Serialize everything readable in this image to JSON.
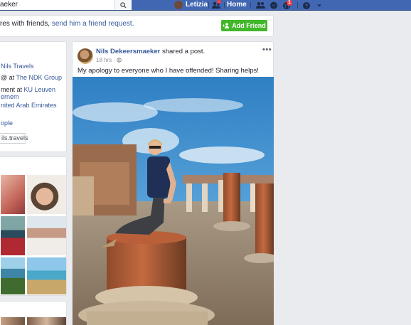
{
  "topbar": {
    "search_value": "aeker",
    "user_name": "Letizia",
    "home_label": "Home",
    "friend_requests_badge": "",
    "notifications_badge": "1",
    "brand_color": "#4267b2"
  },
  "banner": {
    "text_prefix": "res with friends, ",
    "text_link": "send him a friend request.",
    "add_friend_label": "Add Friend",
    "button_color": "#42b72a"
  },
  "intro": {
    "lines": [
      {
        "pre": "",
        "link": "Nils Travels"
      },
      {
        "pre": "@ at ",
        "link": "The NDK Group"
      },
      {
        "pre": "ment at ",
        "link": "KU Leuven"
      },
      {
        "pre": "",
        "link": "ernem"
      },
      {
        "pre": "",
        "link": "nited Arab Emirates"
      },
      {
        "pre": "",
        "link": "ople"
      }
    ],
    "pill_label": "ils.travels"
  },
  "post": {
    "author": "Nils Dekeersmaeker",
    "action": " shared a post.",
    "time": "18 hrs",
    "privacy_icon": "globe-icon",
    "text": "My apology to everyone who I have offended! Sharing helps!",
    "menu_label": "•••"
  }
}
